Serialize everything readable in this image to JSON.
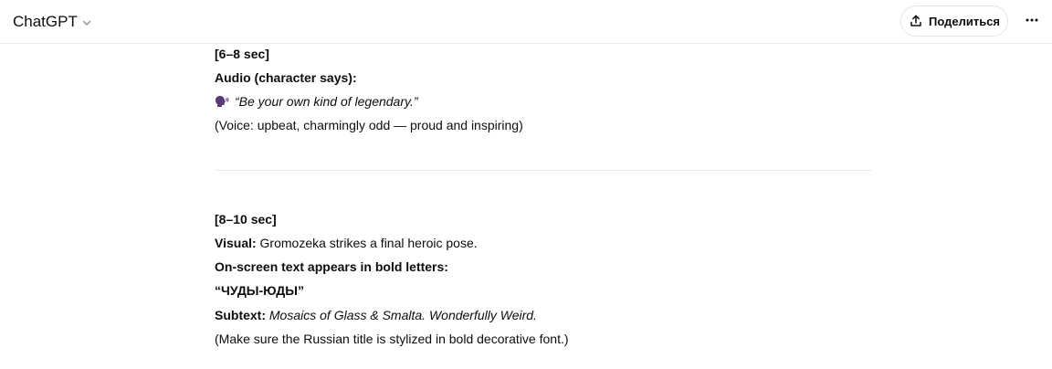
{
  "header": {
    "model_name": "ChatGPT",
    "share_label": "Поделиться"
  },
  "icons": {
    "model_chevron": "chevron-down-icon",
    "share": "share-upload-icon",
    "more": "more-horizontal-icon",
    "speech": "speaking-head-icon"
  },
  "message": {
    "section1": {
      "time": "[6–8 sec]",
      "audio_label": "Audio (character says):",
      "quote": "“Be your own kind of legendary.”",
      "voice_note": "(Voice: upbeat, charmingly odd — proud and inspiring)"
    },
    "section2": {
      "time": "[8–10 sec]",
      "visual_label": "Visual:",
      "visual_text": " Gromozeka strikes a final heroic pose.",
      "onscreen_label": "On-screen text appears in bold letters:",
      "title_text": "“ЧУДЫ-ЮДЫ”",
      "subtext_label": "Subtext:",
      "subtext_value": " Mosaics of Glass & Smalta. Wonderfully Weird.",
      "note": "(Make sure the Russian title is stylized in bold decorative font.)"
    }
  }
}
